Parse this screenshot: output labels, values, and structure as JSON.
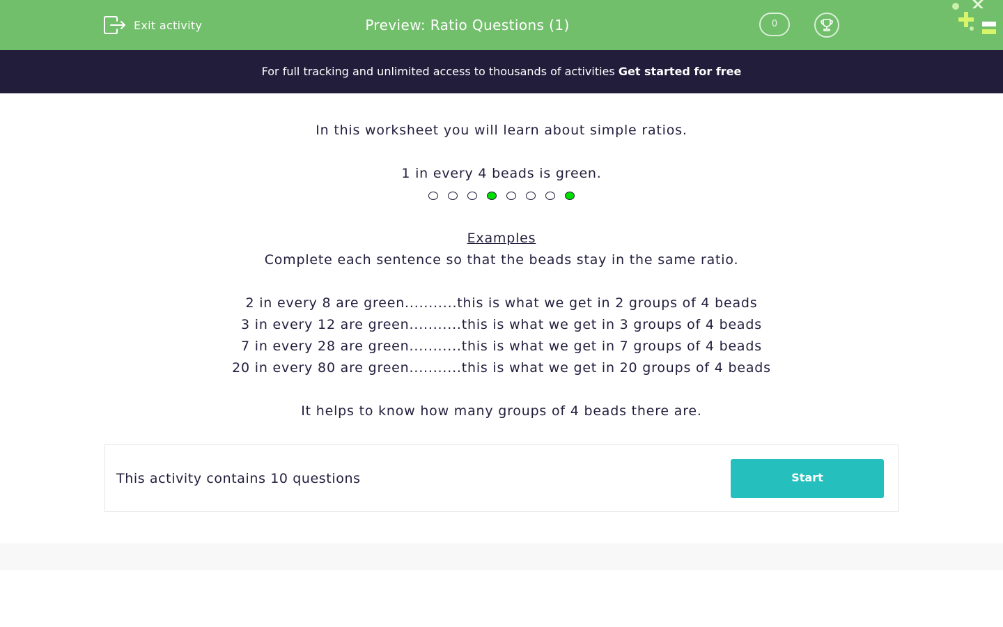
{
  "header": {
    "exit_label": "Exit activity",
    "title": "Preview: Ratio Questions (1)",
    "score": "0",
    "bg_color": "#71be6b"
  },
  "banner": {
    "text": "For full tracking and unlimited access to thousands of activities ",
    "cta": "Get started for free",
    "bg_color": "#231d3c"
  },
  "content": {
    "intro": "In this worksheet you will learn about simple ratios.",
    "ratio_statement": "1 in every 4 beads is green.",
    "beads": [
      false,
      false,
      false,
      true,
      false,
      false,
      false,
      true
    ],
    "examples_heading": "Examples",
    "instruction": "Complete each sentence so that the beads stay in the same ratio.",
    "examples": [
      "2 in every 8 are green...........this is what we get in 2 groups of 4 beads",
      "3 in every 12 are green...........this is what we get in 3 groups of 4 beads",
      "7 in every 28 are green...........this is what we get in 7 groups of 4 beads",
      "20 in every 80 are green...........this is what we get in 20 groups of 4 beads"
    ],
    "tip": "It helps to know how many groups of 4 beads there are."
  },
  "activity": {
    "count_text": "This activity contains 10 questions",
    "start_label": "Start",
    "button_color": "#25bfbd"
  }
}
